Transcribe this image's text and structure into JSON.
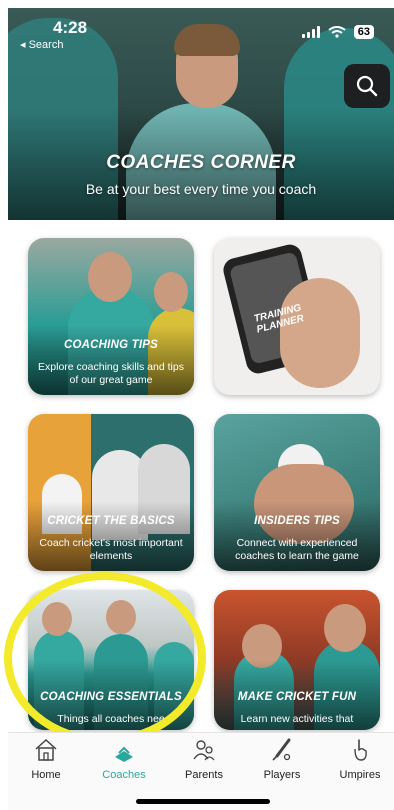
{
  "status_bar": {
    "time": "4:28",
    "back_label": "◂ Search",
    "battery": "63"
  },
  "hero": {
    "title": "COACHES CORNER",
    "subtitle": "Be at your best every time you coach"
  },
  "cards": [
    {
      "title": "COACHING TIPS",
      "description": "Explore coaching skills and tips of our great game"
    },
    {
      "title": "",
      "description": "",
      "image_text": "TRAINING PLANNER"
    },
    {
      "title": "CRICKET THE BASICS",
      "description": "Coach cricket's most important elements"
    },
    {
      "title": "INSIDERS TIPS",
      "description": "Connect with experienced coaches to learn the game"
    },
    {
      "title": "COACHING ESSENTIALS",
      "description": "Things all coaches nee"
    },
    {
      "title": "MAKE CRICKET FUN",
      "description": "Learn new activities that"
    }
  ],
  "tabs": [
    {
      "label": "Home",
      "icon": "home-icon",
      "active": false
    },
    {
      "label": "Coaches",
      "icon": "coaches-icon",
      "active": true
    },
    {
      "label": "Parents",
      "icon": "parents-icon",
      "active": false
    },
    {
      "label": "Players",
      "icon": "players-icon",
      "active": false
    },
    {
      "label": "Umpires",
      "icon": "umpires-icon",
      "active": false
    }
  ],
  "colors": {
    "accent": "#2aa79d",
    "highlight": "#f2ea2a",
    "search_button": "#1d1f20"
  }
}
